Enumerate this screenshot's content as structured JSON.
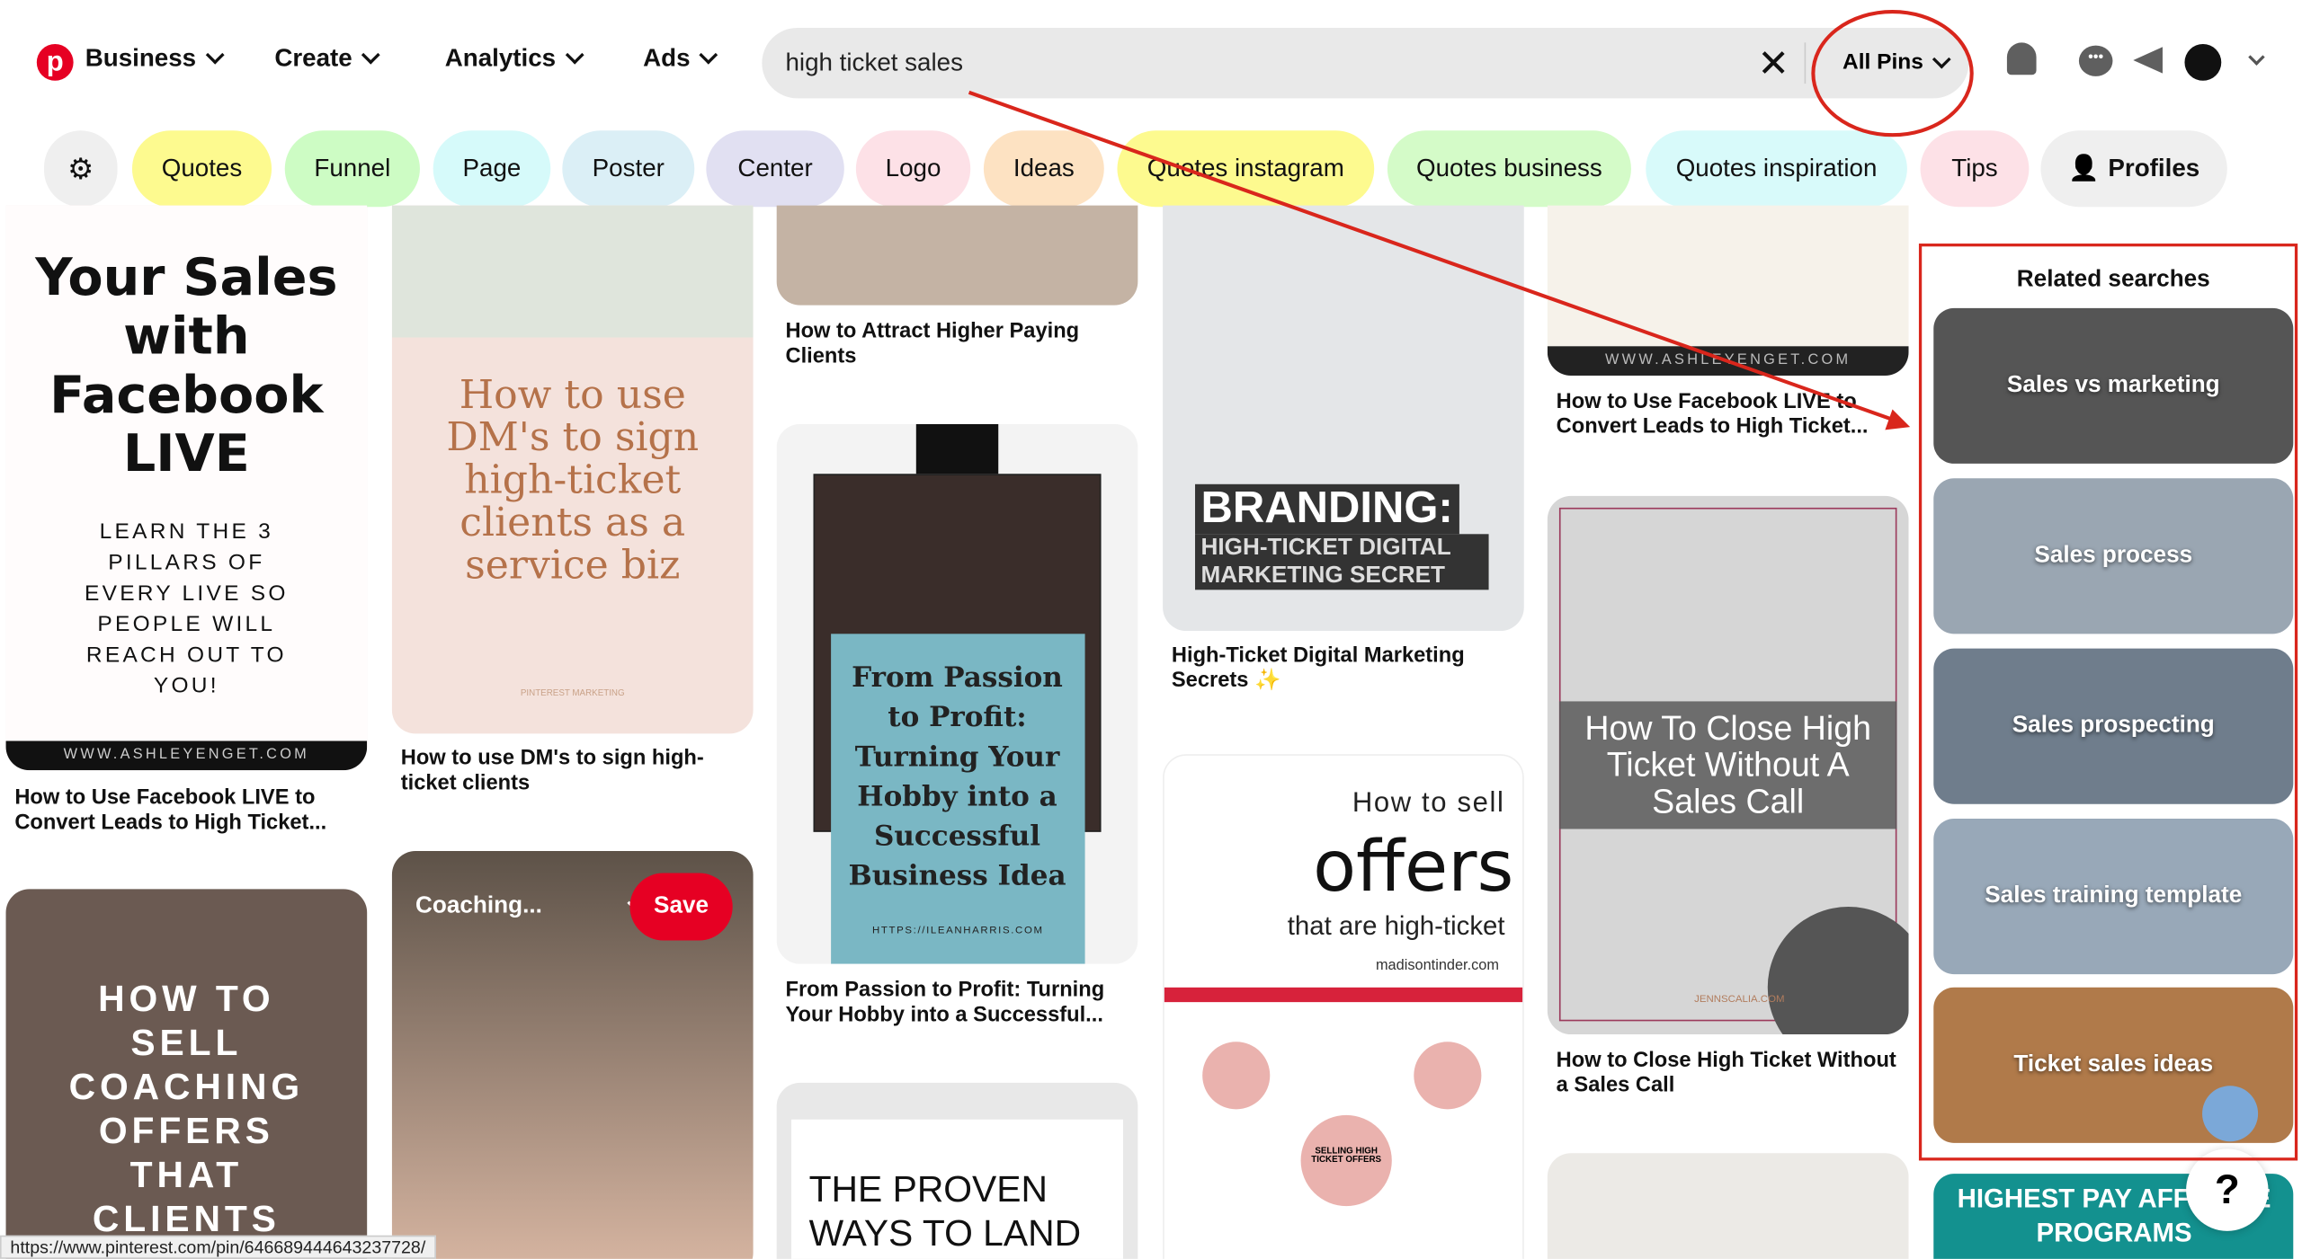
{
  "header": {
    "brand": "Business",
    "nav": [
      "Create",
      "Analytics",
      "Ads"
    ],
    "search_value": "high ticket sales",
    "filter": "All Pins",
    "accent": "#e60023"
  },
  "chips": [
    {
      "label": "Quotes",
      "color": "#fdfa8f"
    },
    {
      "label": "Funnel",
      "color": "#cdfcc4"
    },
    {
      "label": "Page",
      "color": "#d6fafa"
    },
    {
      "label": "Poster",
      "color": "#dbeff6"
    },
    {
      "label": "Center",
      "color": "#e1e0f2"
    },
    {
      "label": "Logo",
      "color": "#fde1e7"
    },
    {
      "label": "Ideas",
      "color": "#fde2c2"
    },
    {
      "label": "Quotes instagram",
      "color": "#fdfa8f"
    },
    {
      "label": "Quotes business",
      "color": "#d4fbc8"
    },
    {
      "label": "Quotes inspiration",
      "color": "#d8fafa"
    },
    {
      "label": "Tips",
      "color": "#fde1e7"
    },
    {
      "label": "Profiles",
      "color": "#efefef"
    }
  ],
  "pins": {
    "c1p1": {
      "image_text": "Your Sales with Facebook LIVE",
      "sub": "LEARN THE 3 PILLARS OF EVERY LIVE SO PEOPLE WILL REACH OUT TO YOU!",
      "footer": "WWW.ASHLEYENGET.COM",
      "title": "How to Use Facebook LIVE to Convert Leads to High Ticket..."
    },
    "c1p2": {
      "image_text": "HOW TO SELL COACHING OFFERS THAT CLIENTS"
    },
    "c2p1": {
      "image_text": "How to use DM's to sign high-ticket clients as a service biz",
      "footer": "PINTEREST MARKETING",
      "title": "How to use DM's to sign high-ticket clients"
    },
    "c2p2": {
      "board": "Coaching...",
      "save": "Save"
    },
    "c3p1": {
      "title": "How to Attract Higher Paying Clients"
    },
    "c3p2": {
      "image_text": "From Passion to Profit: Turning Your Hobby into a Successful Business Idea",
      "footer": "HTTPS://ILEANHARRIS.COM",
      "title": "From Passion to Profit: Turning Your Hobby into a Successful..."
    },
    "c3p3": {
      "image_text": "THE PROVEN WAYS TO LAND"
    },
    "c4p1": {
      "image_text": "BRANDING:",
      "sub": "HIGH-TICKET DIGITAL MARKETING SECRET",
      "title": "High-Ticket Digital Marketing Secrets ✨"
    },
    "c4p2": {
      "l1": "How to sell",
      "l2": "offers",
      "l3": "that are high-ticket",
      "site": "madisontinder.com",
      "center": "SELLING HIGH TICKET OFFERS"
    },
    "c5p1": {
      "footer": "WWW.ASHLEYENGET.COM",
      "title": "How to Use Facebook LIVE to Convert Leads to High Ticket..."
    },
    "c5p2": {
      "image_text": "How To Close High Ticket Without A Sales Call",
      "footer": "JENNSCALIA.COM",
      "title": "How to Close High Ticket Without a Sales Call"
    }
  },
  "related": {
    "heading": "Related searches",
    "items": [
      {
        "label": "Sales vs marketing",
        "color": "#555"
      },
      {
        "label": "Sales process",
        "color": "#9aa6b2"
      },
      {
        "label": "Sales prospecting",
        "color": "#6f7d8c"
      },
      {
        "label": "Sales training template",
        "color": "#98a8b8"
      },
      {
        "label": "Ticket sales ideas",
        "color": "#b07a4a"
      }
    ]
  },
  "sidebar_pin": {
    "image_text": "HIGHEST PAY AFFILIATE PROGRAMS"
  },
  "help": "?",
  "status_url": "https://www.pinterest.com/pin/646689444643237728/",
  "annotation_color": "#d9261c"
}
